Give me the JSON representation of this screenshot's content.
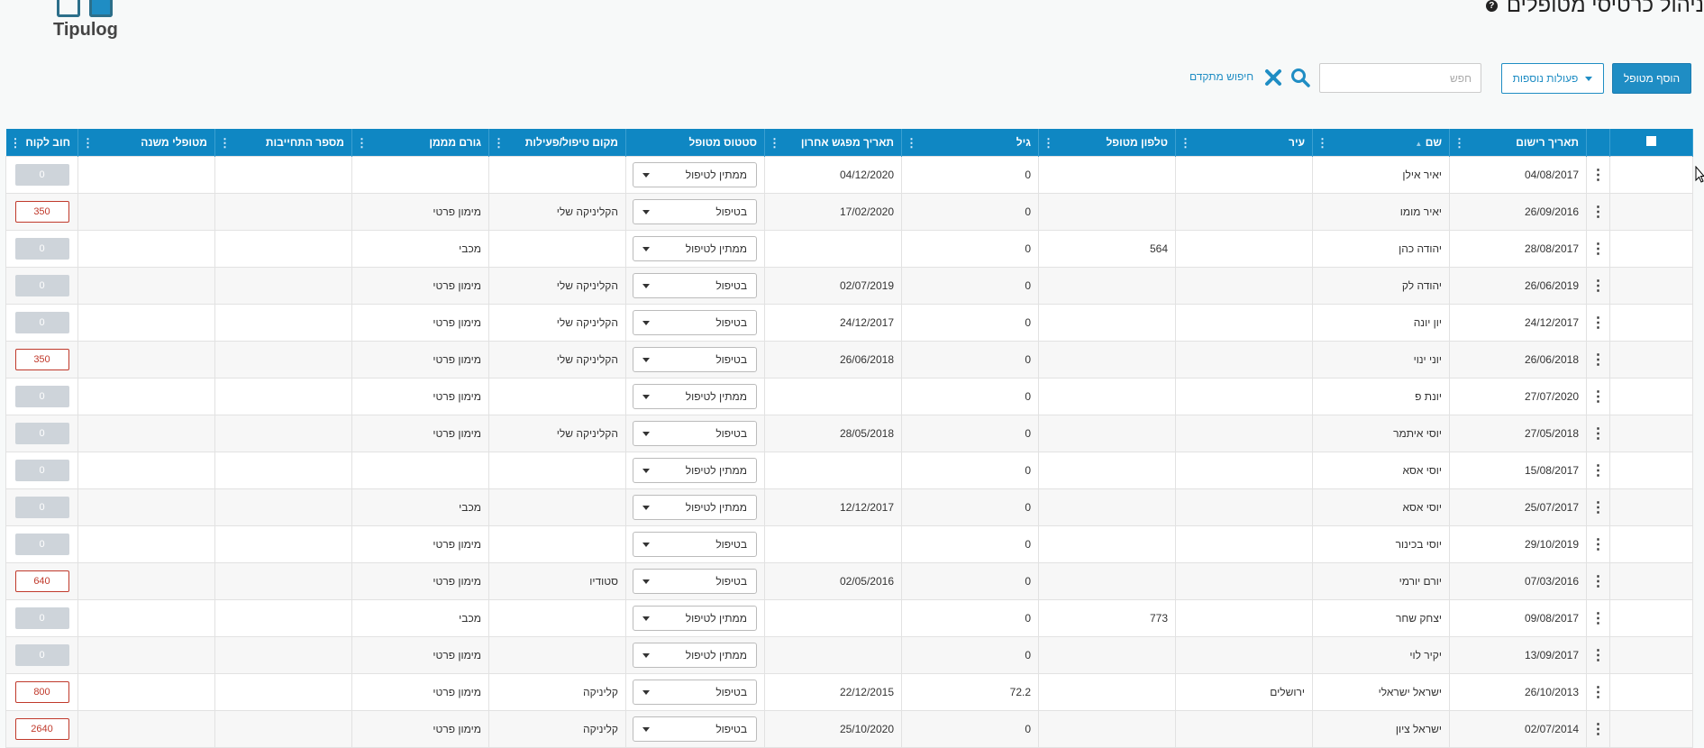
{
  "header": {
    "brand": "Tipulog",
    "title": "ניהול כרטיסי מטופלים"
  },
  "toolbar": {
    "add_label": "הוסף מטופל",
    "more_label": "פעולות נוספות",
    "search_placeholder": "חפש",
    "search_value": "",
    "advanced_label": "חיפוש מתקדם"
  },
  "colors": {
    "header_blue": "#0f87c3",
    "debt_red": "#c0392b",
    "debt_zero_bg": "#ced4da"
  },
  "table": {
    "columns": [
      "תאריך רישום",
      "שם",
      "עיר",
      "טלפון מטופל",
      "גיל",
      "תאריך מפגש אחרון",
      "סטטוס מטופל",
      "מקום טיפול/פעילות",
      "גורם מממן",
      "מספר התחייבות",
      "מטופלי משנה",
      "חוב לקוח"
    ],
    "rows": [
      {
        "reg_date": "04/08/2017",
        "name": "יאיר אילן",
        "city": "",
        "phone": "",
        "age": "0",
        "last_meeting": "04/12/2020",
        "status": "ממתין לטיפול",
        "place": "",
        "funder": "",
        "commitment": "",
        "sub": "",
        "debt": "0"
      },
      {
        "reg_date": "26/09/2016",
        "name": "יאיר מומו",
        "city": "",
        "phone": "",
        "age": "0",
        "last_meeting": "17/02/2020",
        "status": "בטיפול",
        "place": "הקליניקה שלי",
        "funder": "מימון פרטי",
        "commitment": "",
        "sub": "",
        "debt": "350"
      },
      {
        "reg_date": "28/08/2017",
        "name": "יהודה כהן",
        "city": "",
        "phone": "564",
        "age": "0",
        "last_meeting": "",
        "status": "ממתין לטיפול",
        "place": "",
        "funder": "מכבי",
        "commitment": "",
        "sub": "",
        "debt": "0"
      },
      {
        "reg_date": "26/06/2019",
        "name": "יהודה לק",
        "city": "",
        "phone": "",
        "age": "0",
        "last_meeting": "02/07/2019",
        "status": "בטיפול",
        "place": "הקליניקה שלי",
        "funder": "מימון פרטי",
        "commitment": "",
        "sub": "",
        "debt": "0"
      },
      {
        "reg_date": "24/12/2017",
        "name": "יון יונה",
        "city": "",
        "phone": "",
        "age": "0",
        "last_meeting": "24/12/2017",
        "status": "בטיפול",
        "place": "הקליניקה שלי",
        "funder": "מימון פרטי",
        "commitment": "",
        "sub": "",
        "debt": "0"
      },
      {
        "reg_date": "26/06/2018",
        "name": "יוני ינוי",
        "city": "",
        "phone": "",
        "age": "0",
        "last_meeting": "26/06/2018",
        "status": "בטיפול",
        "place": "הקליניקה שלי",
        "funder": "מימון פרטי",
        "commitment": "",
        "sub": "",
        "debt": "350"
      },
      {
        "reg_date": "27/07/2020",
        "name": "יונת פ",
        "city": "",
        "phone": "",
        "age": "0",
        "last_meeting": "",
        "status": "ממתין לטיפול",
        "place": "",
        "funder": "מימון פרטי",
        "commitment": "",
        "sub": "",
        "debt": "0"
      },
      {
        "reg_date": "27/05/2018",
        "name": "יוסי איתמר",
        "city": "",
        "phone": "",
        "age": "0",
        "last_meeting": "28/05/2018",
        "status": "בטיפול",
        "place": "הקליניקה שלי",
        "funder": "מימון פרטי",
        "commitment": "",
        "sub": "",
        "debt": "0"
      },
      {
        "reg_date": "15/08/2017",
        "name": "יוסי אסא",
        "city": "",
        "phone": "",
        "age": "0",
        "last_meeting": "",
        "status": "ממתין לטיפול",
        "place": "",
        "funder": "",
        "commitment": "",
        "sub": "",
        "debt": "0"
      },
      {
        "reg_date": "25/07/2017",
        "name": "יוסי אסא",
        "city": "",
        "phone": "",
        "age": "0",
        "last_meeting": "12/12/2017",
        "status": "ממתין לטיפול",
        "place": "",
        "funder": "מכבי",
        "commitment": "",
        "sub": "",
        "debt": "0"
      },
      {
        "reg_date": "29/10/2019",
        "name": "יוסי בכינור",
        "city": "",
        "phone": "",
        "age": "0",
        "last_meeting": "",
        "status": "בטיפול",
        "place": "",
        "funder": "מימון פרטי",
        "commitment": "",
        "sub": "",
        "debt": "0"
      },
      {
        "reg_date": "07/03/2016",
        "name": "יורם יורמי",
        "city": "",
        "phone": "",
        "age": "0",
        "last_meeting": "02/05/2016",
        "status": "בטיפול",
        "place": "סטודיו",
        "funder": "מימון פרטי",
        "commitment": "",
        "sub": "",
        "debt": "640"
      },
      {
        "reg_date": "09/08/2017",
        "name": "יצחק שחר",
        "city": "",
        "phone": "773",
        "age": "0",
        "last_meeting": "",
        "status": "ממתין לטיפול",
        "place": "",
        "funder": "מכבי",
        "commitment": "",
        "sub": "",
        "debt": "0"
      },
      {
        "reg_date": "13/09/2017",
        "name": "יקיר לוי",
        "city": "",
        "phone": "",
        "age": "0",
        "last_meeting": "",
        "status": "ממתין לטיפול",
        "place": "",
        "funder": "מימון פרטי",
        "commitment": "",
        "sub": "",
        "debt": "0"
      },
      {
        "reg_date": "26/10/2013",
        "name": "ישראל ישראלי",
        "city": "ירושלים",
        "phone": "",
        "age": "72.2",
        "last_meeting": "22/12/2015",
        "status": "בטיפול",
        "place": "קליניקה",
        "funder": "מימון פרטי",
        "commitment": "",
        "sub": "",
        "debt": "800"
      },
      {
        "reg_date": "02/07/2014",
        "name": "ישראל ציון",
        "city": "",
        "phone": "",
        "age": "0",
        "last_meeting": "25/10/2020",
        "status": "בטיפול",
        "place": "קליניקה",
        "funder": "מימון פרטי",
        "commitment": "",
        "sub": "",
        "debt": "2640"
      }
    ]
  }
}
